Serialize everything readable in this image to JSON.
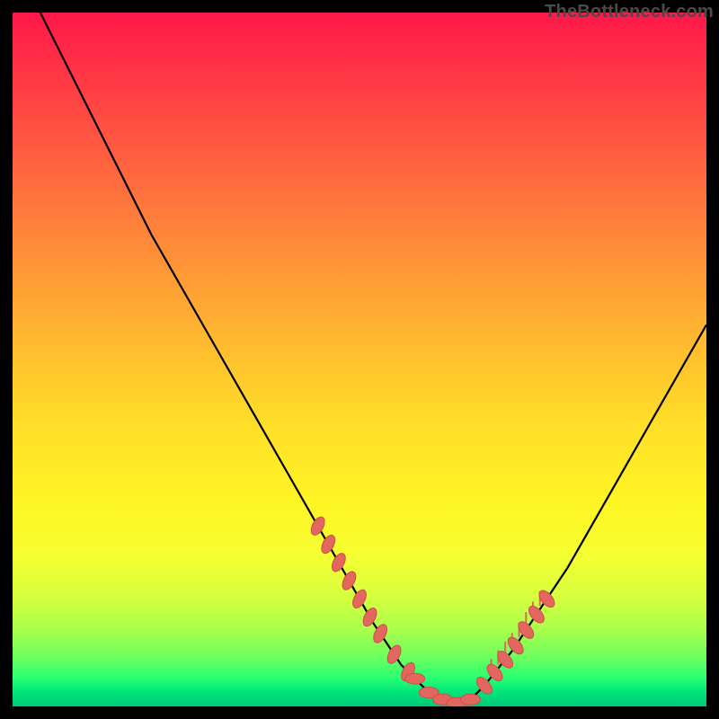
{
  "watermark": "TheBottleneck.com",
  "colors": {
    "page_bg": "#000000",
    "curve_stroke": "#000000",
    "marker_fill": "#e4675f",
    "marker_stroke": "#c95049",
    "tick_stroke": "#e4675f"
  },
  "chart_data": {
    "type": "line",
    "title": "",
    "xlabel": "",
    "ylabel": "",
    "xlim": [
      0,
      100
    ],
    "ylim": [
      0,
      100
    ],
    "grid": false,
    "legend": false,
    "series": [
      {
        "name": "bottleneck-curve",
        "x": [
          4,
          8,
          12,
          16,
          20,
          24,
          28,
          32,
          36,
          40,
          44,
          48,
          52,
          56,
          58,
          60,
          62,
          64,
          66,
          68,
          72,
          76,
          80,
          84,
          88,
          92,
          96,
          100
        ],
        "y": [
          100,
          92,
          84,
          76,
          68,
          61,
          54,
          47,
          40,
          33,
          26,
          19,
          12,
          6,
          4,
          2,
          1,
          0.5,
          1,
          3,
          8,
          14,
          20,
          27,
          34,
          41,
          48,
          55
        ]
      }
    ],
    "markers": {
      "left_segment_x": [
        44,
        45.5,
        47,
        48.5,
        50,
        51.5,
        53,
        55,
        57
      ],
      "flat_segment_x": [
        58,
        60,
        62,
        64,
        66
      ],
      "right_segment_x": [
        68,
        69.5,
        71,
        72.5,
        74,
        75.5,
        77
      ],
      "right_ticks_x": [
        69,
        70,
        71,
        72,
        73,
        74,
        75,
        76
      ]
    },
    "gradient_stops": [
      {
        "pos": 0,
        "color": "#ff1749"
      },
      {
        "pos": 10,
        "color": "#ff3a45"
      },
      {
        "pos": 24,
        "color": "#ff6a3e"
      },
      {
        "pos": 38,
        "color": "#ff9a36"
      },
      {
        "pos": 50,
        "color": "#ffc22e"
      },
      {
        "pos": 60,
        "color": "#ffe028"
      },
      {
        "pos": 70,
        "color": "#fff424"
      },
      {
        "pos": 78,
        "color": "#f6ff30"
      },
      {
        "pos": 84,
        "color": "#d8ff3e"
      },
      {
        "pos": 89,
        "color": "#a8ff4c"
      },
      {
        "pos": 93,
        "color": "#6cff5e"
      },
      {
        "pos": 96,
        "color": "#26ff74"
      },
      {
        "pos": 98,
        "color": "#00e47a"
      },
      {
        "pos": 100,
        "color": "#00c979"
      }
    ]
  }
}
